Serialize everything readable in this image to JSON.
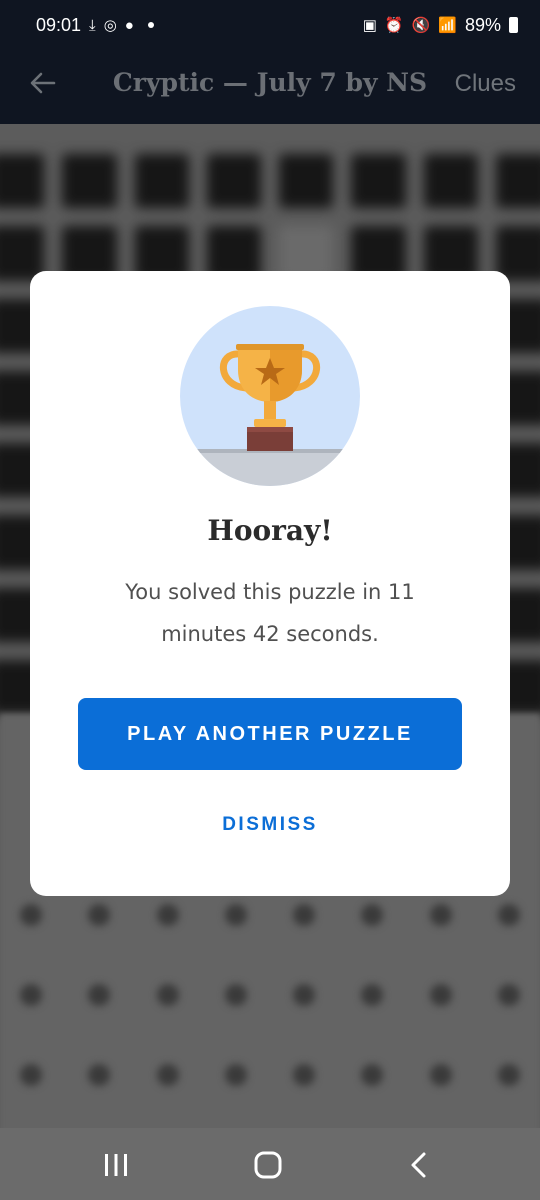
{
  "status_bar": {
    "time": "09:01",
    "battery_percent": "89%",
    "notification_icons": [
      "download-icon",
      "instagram-icon",
      "facebook-icon"
    ],
    "system_icons": [
      "nfc-icon",
      "alarm-icon",
      "mute-icon",
      "wifi-icon",
      "signal-icon",
      "battery-icon"
    ]
  },
  "app_bar": {
    "title": "Cryptic — July 7 by NS",
    "clues_label": "Clues",
    "back_icon": "back-arrow-icon"
  },
  "modal": {
    "illustration": "trophy-icon",
    "title": "Hooray!",
    "message": "You solved this puzzle in 11 minutes 42 seconds.",
    "primary_button": "PLAY ANOTHER PUZZLE",
    "dismiss_button": "DISMISS"
  },
  "nav_bar": {
    "icons": [
      "recent-apps-icon",
      "home-icon",
      "back-icon"
    ]
  },
  "colors": {
    "accent": "#0b6ed7",
    "app_bar_bg": "#0f1521",
    "trophy_circle": "#cfe2fb"
  }
}
